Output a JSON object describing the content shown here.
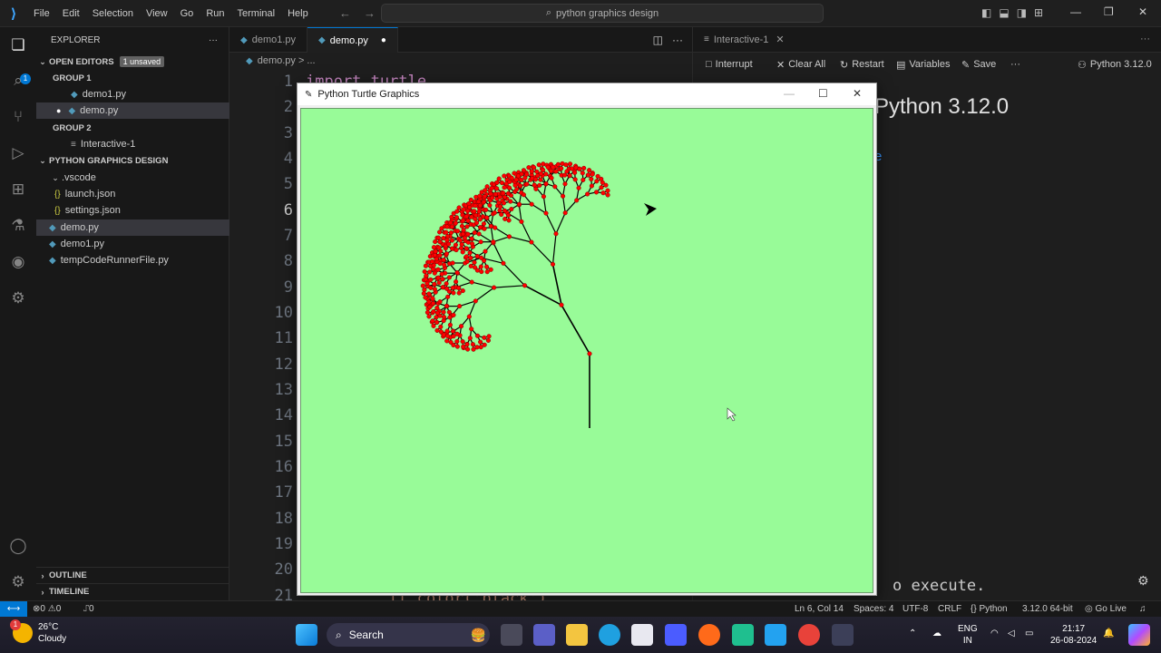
{
  "titlebar": {
    "menu": [
      "File",
      "Edit",
      "Selection",
      "View",
      "Go",
      "Run",
      "Terminal",
      "Help"
    ],
    "search_text": "python graphics design"
  },
  "sidebar": {
    "title": "EXPLORER",
    "open_editors": "OPEN EDITORS",
    "unsaved_badge": "1 unsaved",
    "group1": "GROUP 1",
    "group1_items": [
      "demo1.py",
      "demo.py"
    ],
    "group2": "GROUP 2",
    "group2_items": [
      "Interactive-1"
    ],
    "project": "PYTHON GRAPHICS DESIGN",
    "folder": ".vscode",
    "folder_items": [
      "launch.json",
      "settings.json"
    ],
    "files": [
      "demo.py",
      "demo1.py",
      "tempCodeRunnerFile.py"
    ],
    "outline": "OUTLINE",
    "timeline": "TIMELINE"
  },
  "editor": {
    "tabs": [
      "demo1.py",
      "demo.py"
    ],
    "breadcrumb": "demo.py > ...",
    "line_numbers": [
      "1",
      "2",
      "3",
      "4",
      "5",
      "6",
      "7",
      "8",
      "9",
      "10",
      "11",
      "12",
      "13",
      "14",
      "15",
      "16",
      "17",
      "18",
      "19",
      "20",
      "21"
    ],
    "current_line": "6",
    "code_line1": "import turtle",
    "code_line21": "tt.color('black')"
  },
  "interactive": {
    "tab": "Interactive-1",
    "toolbar": [
      "Interrupt",
      "Clear All",
      "Restart",
      "Variables",
      "Save"
    ],
    "kernel": "Python 3.12.0",
    "heading": "Python 3.12.0",
    "exec_hint": "o execute."
  },
  "turtle_window": {
    "title": "Python Turtle Graphics",
    "background": "#98fb98",
    "branch_color": "#000000",
    "leaf_color": "#ff0000"
  },
  "status": {
    "errors": "0",
    "warnings": "0",
    "ports": "0",
    "position": "Ln 6, Col 14",
    "spaces": "Spaces: 4",
    "encoding": "UTF-8",
    "eol": "CRLF",
    "language": "Python",
    "interpreter": "3.12.0 64-bit",
    "golive": "Go Live"
  },
  "taskbar": {
    "weather_temp": "26°C",
    "weather_desc": "Cloudy",
    "weather_badge": "1",
    "search": "Search",
    "lang1": "ENG",
    "lang2": "IN",
    "time": "21:17",
    "date": "26-08-2024"
  }
}
